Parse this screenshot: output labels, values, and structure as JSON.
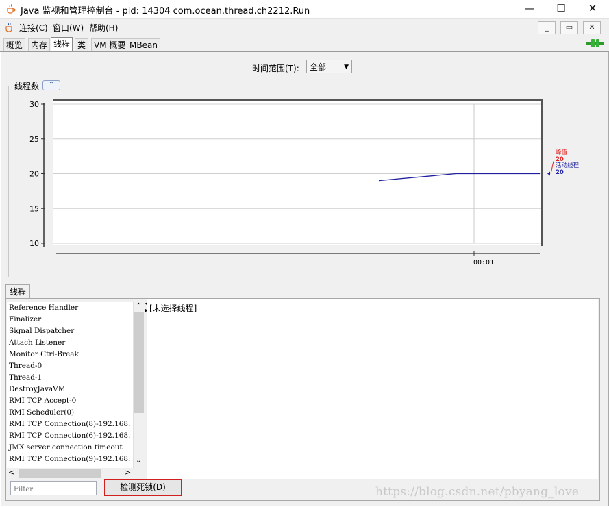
{
  "window": {
    "title": "Java 监视和管理控制台 - pid: 14304 com.ocean.thread.ch2212.Run",
    "minimize": "—",
    "maximize": "☐",
    "close": "✕"
  },
  "menu": {
    "items": [
      "连接(C)",
      "窗口(W)",
      "帮助(H)"
    ],
    "mdi": {
      "minimize": "_",
      "restore": "▭",
      "close": "✕"
    }
  },
  "tabs": [
    {
      "label": "概览",
      "selected": false
    },
    {
      "label": "内存",
      "selected": false
    },
    {
      "label": "线程",
      "selected": true
    },
    {
      "label": "类",
      "selected": false
    },
    {
      "label": "VM 概要",
      "selected": false
    },
    {
      "label": "MBean",
      "selected": false
    }
  ],
  "time_range": {
    "label": "时间范围(T):",
    "value": "全部"
  },
  "chart_title": "线程数",
  "chart_data": {
    "type": "line",
    "title": "线程数",
    "xlabel": "",
    "ylabel": "",
    "ylim": [
      10,
      30
    ],
    "yticks": [
      10,
      15,
      20,
      25,
      30
    ],
    "xticks": [
      "00:01"
    ],
    "grid": true,
    "series": [
      {
        "name": "活动线程",
        "color": "#1f1fa0",
        "x_frac": [
          0,
          0.48,
          1.0
        ],
        "values": [
          19,
          20,
          20
        ]
      }
    ],
    "legend": [
      {
        "label": "峰值",
        "value": "20",
        "color": "#e02020"
      },
      {
        "label": "活动线程",
        "value": "20",
        "color": "#1f1fa0"
      }
    ]
  },
  "threads_tab": "线程",
  "threads": [
    "Reference Handler",
    "Finalizer",
    "Signal Dispatcher",
    "Attach Listener",
    "Monitor Ctrl-Break",
    "Thread-0",
    "Thread-1",
    "DestroyJavaVM",
    "RMI TCP Accept-0",
    "RMI Scheduler(0)",
    "RMI TCP Connection(8)-192.168.",
    "RMI TCP Connection(6)-192.168.",
    "JMX server connection timeout",
    "RMI TCP Connection(9)-192.168."
  ],
  "detail_text": "[未选择线程]",
  "filter_placeholder": "Filter",
  "deadlock_button": "检测死锁(D)",
  "watermark": "https://blog.csdn.net/pbyang_love"
}
